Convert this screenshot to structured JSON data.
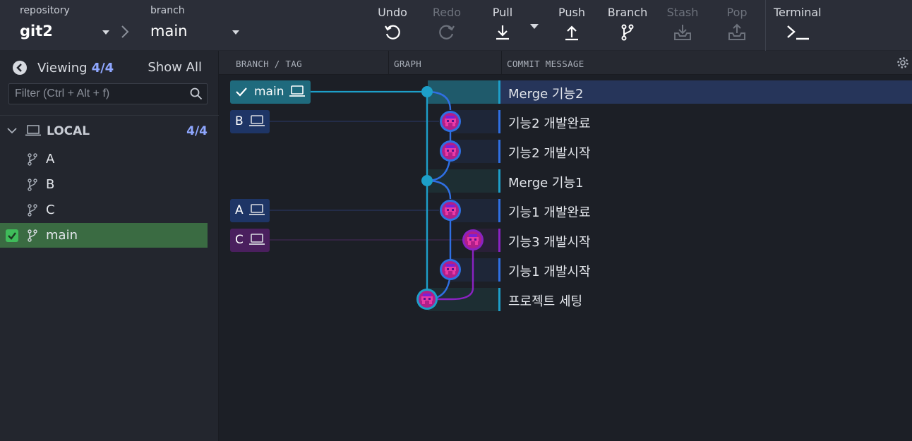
{
  "toolbar": {
    "repository_label": "repository",
    "repository_value": "git2",
    "branch_label": "branch",
    "branch_value": "main",
    "buttons": {
      "undo": "Undo",
      "redo": "Redo",
      "pull": "Pull",
      "push": "Push",
      "branch": "Branch",
      "stash": "Stash",
      "pop": "Pop",
      "terminal": "Terminal"
    }
  },
  "sidebar": {
    "viewing_label": "Viewing",
    "viewing_count": "4/4",
    "show_all": "Show All",
    "filter_placeholder": "Filter (Ctrl + Alt + f)",
    "local_label": "LOCAL",
    "local_count": "4/4",
    "branches": [
      {
        "label": "A",
        "active": false
      },
      {
        "label": "B",
        "active": false
      },
      {
        "label": "C",
        "active": false
      },
      {
        "label": "main",
        "active": true
      }
    ]
  },
  "columns": {
    "branch_tag": "BRANCH / TAG",
    "graph": "GRAPH",
    "commit_message": "COMMIT MESSAGE"
  },
  "refs": [
    {
      "label": "main",
      "checked": true
    },
    {
      "label": "B"
    },
    {
      "label": "A"
    },
    {
      "label": "C"
    }
  ],
  "commits": [
    {
      "message": "Merge 기능2",
      "selected": true
    },
    {
      "message": "기능2 개발완료"
    },
    {
      "message": "기능2 개발시작"
    },
    {
      "message": "Merge 기능1"
    },
    {
      "message": "기능1 개발완료"
    },
    {
      "message": "기능3 개발시작"
    },
    {
      "message": "기능1 개발시작"
    },
    {
      "message": "프로젝트 세팅"
    }
  ],
  "colors": {
    "main_lane": "#1d9fc9",
    "blue_lane": "#2f6fe3",
    "purple_lane": "#8a22c2",
    "selected_row": "#26355a",
    "active_branch": "#3a6b42"
  }
}
